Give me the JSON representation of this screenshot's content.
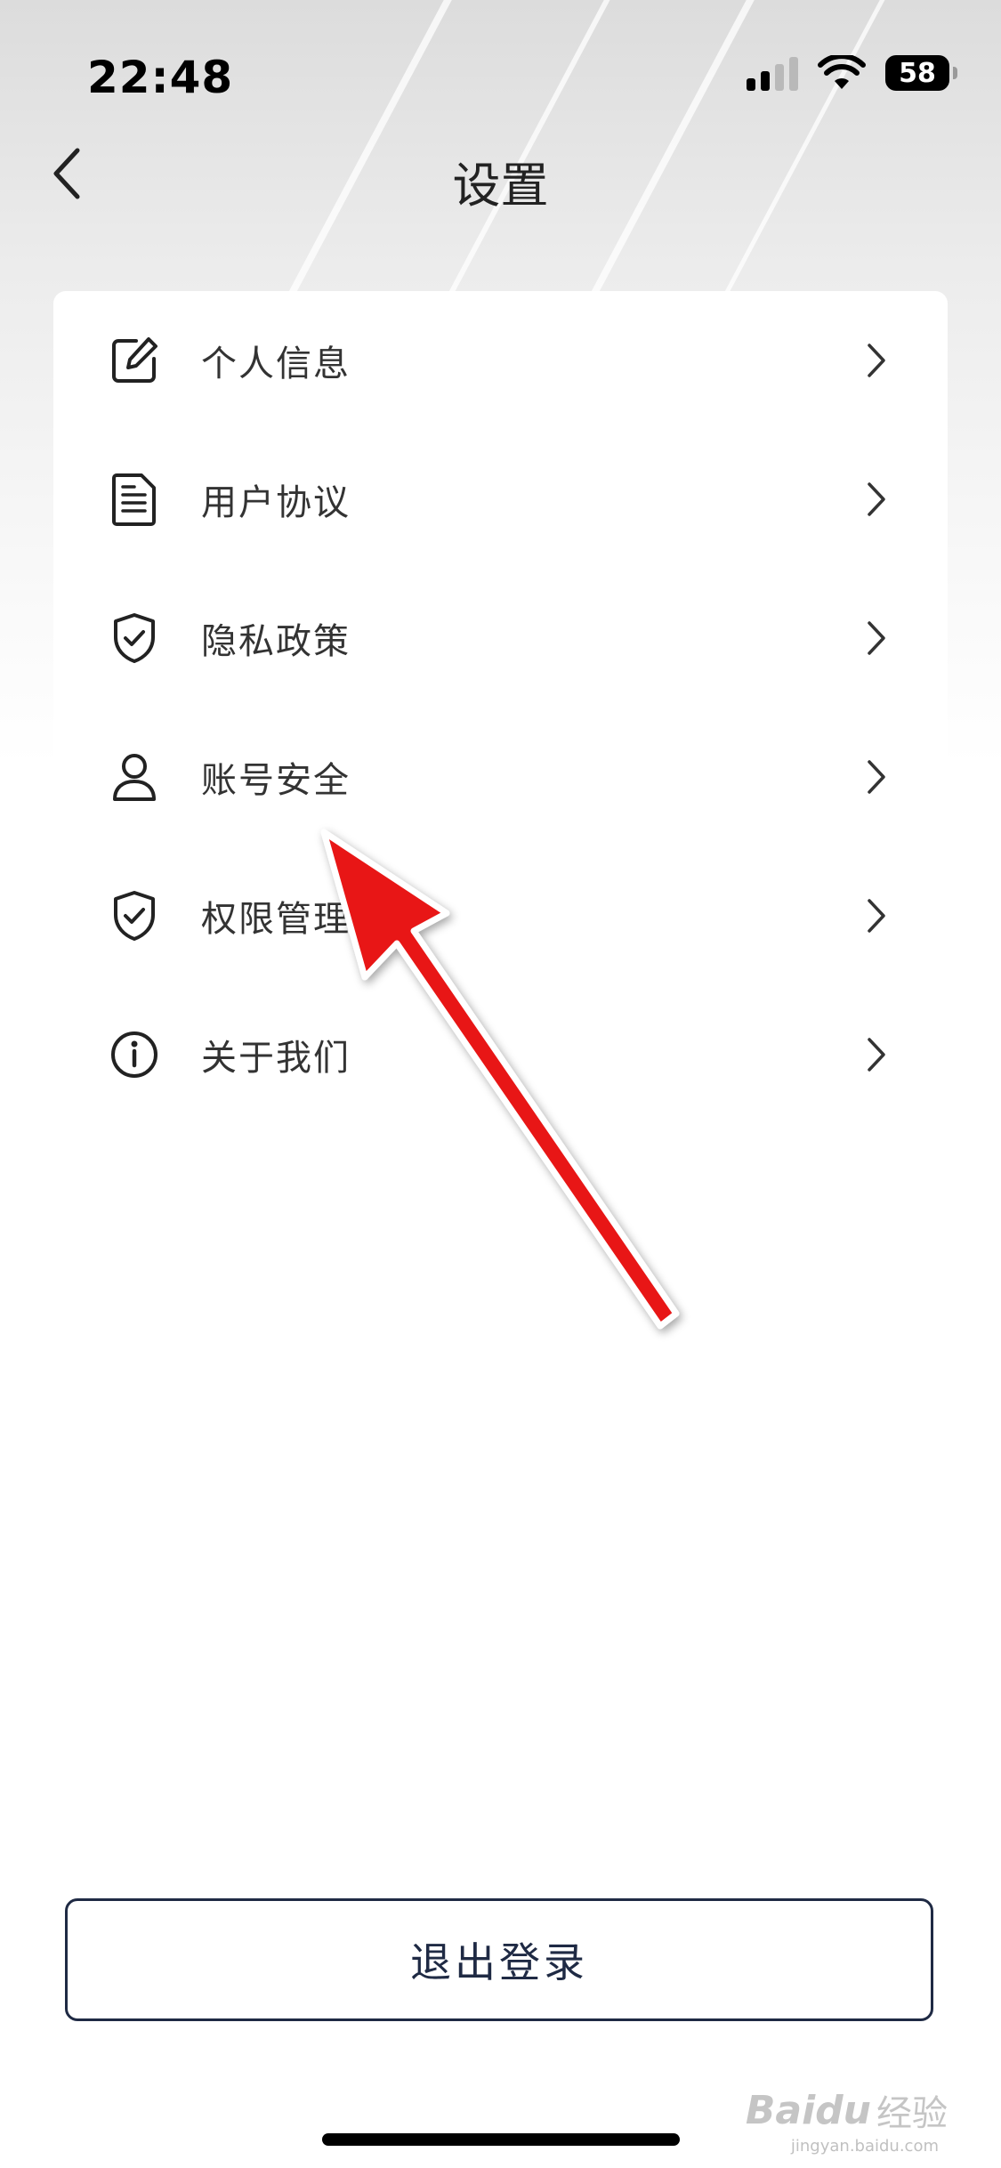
{
  "status_bar": {
    "time": "22:48",
    "battery": "58"
  },
  "nav": {
    "title": "设置",
    "back_icon": "chevron-left-icon"
  },
  "menu": {
    "items": [
      {
        "label": "个人信息",
        "icon": "edit-icon"
      },
      {
        "label": "用户协议",
        "icon": "document-icon"
      },
      {
        "label": "隐私政策",
        "icon": "shield-check-icon"
      },
      {
        "label": "账号安全",
        "icon": "user-icon"
      },
      {
        "label": "权限管理",
        "icon": "shield-check-icon"
      },
      {
        "label": "关于我们",
        "icon": "info-icon"
      }
    ]
  },
  "logout": {
    "label": "退出登录"
  },
  "annotation": {
    "color": "#e81818",
    "points_to": "账号安全"
  },
  "watermark": {
    "brand": "Baidu",
    "cn": "经验",
    "domain": "jingyan.baidu.com"
  },
  "colors": {
    "accent": "#1f2a44",
    "text": "#333333",
    "arrow": "#e81818"
  }
}
